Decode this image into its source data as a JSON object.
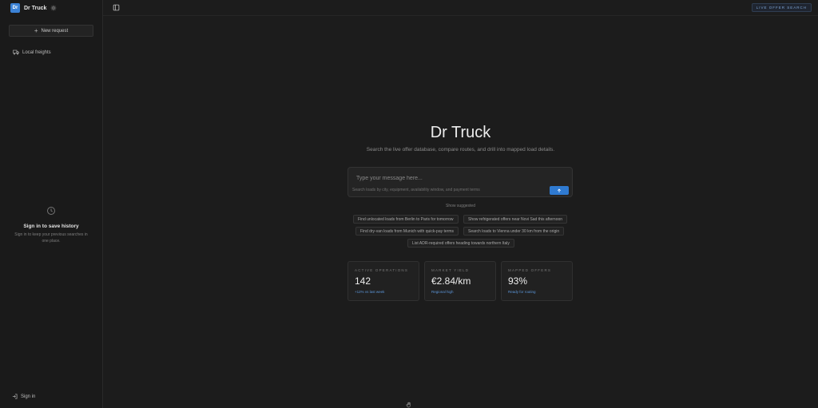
{
  "sidebar": {
    "brand": {
      "logo_text": "Dr",
      "name": "Dr Truck"
    },
    "new_request_label": "New request",
    "nav": [
      {
        "label": "Local freights",
        "icon": "truck-icon"
      }
    ],
    "history": {
      "title": "Sign in to save history",
      "subtitle": "Sign in to keep your previous searches in one place."
    },
    "signin_label": "Sign in"
  },
  "topbar": {
    "live_button_label": "LIVE OFFER SEARCH"
  },
  "main": {
    "title": "Dr Truck",
    "subtitle": "Search the live offer database, compare routes, and drill into mapped load details.",
    "composer": {
      "placeholder": "Type your message here...",
      "hint": "Search loads by city, equipment, availability window, and payment terms"
    },
    "show_suggested": "Show suggested",
    "suggestions": [
      "Find unlocated loads from Berlin to Paris for tomorrow",
      "Show refrigerated offers near Novi Sad this afternoon",
      "Find dry-van loads from Munich with quick-pay terms",
      "Search loads to Vienna under 30 km from the origin",
      "List ADR-required offers heading towards northern Italy"
    ],
    "stats": [
      {
        "label": "ACTIVE OPERATIONS",
        "value": "142",
        "note": "+12% vs last week"
      },
      {
        "label": "MARKET YIELD",
        "value": "€2.84/km",
        "note": "Regional high"
      },
      {
        "label": "MAPPED OFFERS",
        "value": "93%",
        "note": "Ready for routing"
      }
    ]
  },
  "colors": {
    "accent": "#2f7ad1",
    "background": "#1c1c1c",
    "note": "#5b95d8"
  }
}
